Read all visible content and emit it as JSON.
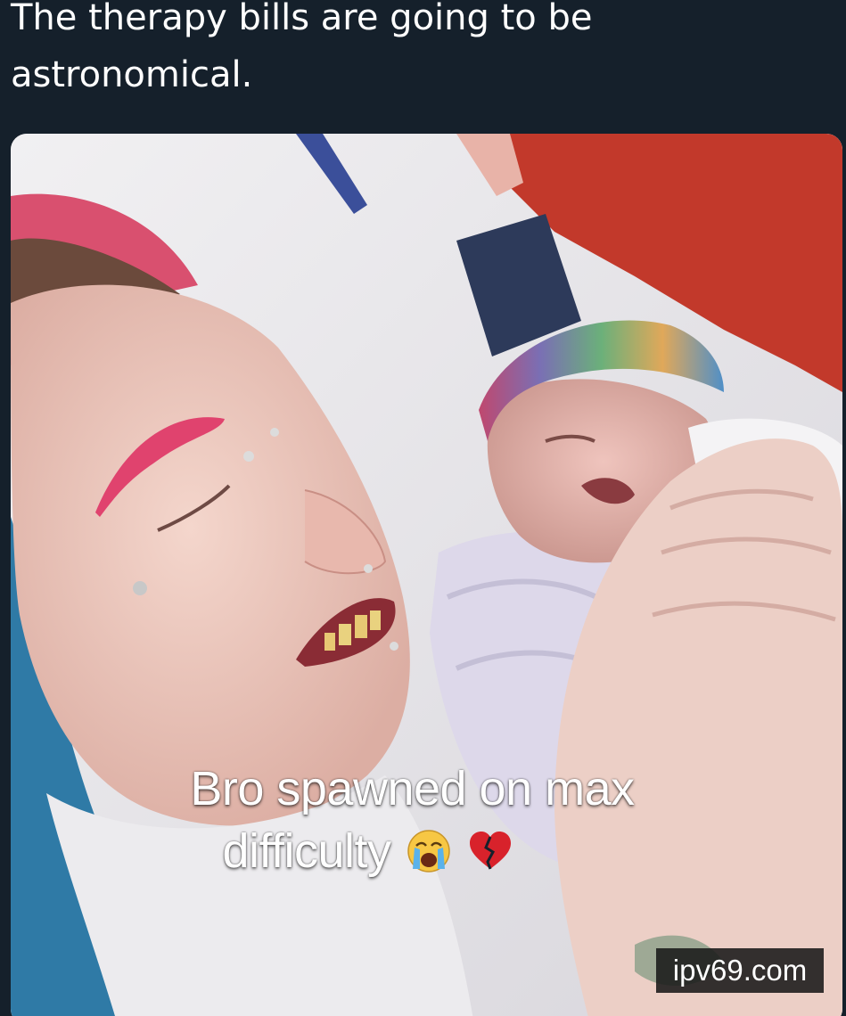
{
  "post": {
    "caption": "The therapy bills are going to be\nastronomical."
  },
  "image": {
    "overlay_line1": "Bro spawned on max",
    "overlay_line2": "difficulty",
    "overlay_emojis": [
      "loudly-crying-face-icon",
      "broken-heart-icon"
    ],
    "watermark": "ipv69.com"
  },
  "colors": {
    "background": "#15202b",
    "caption_text": "#ffffff",
    "watermark_bg": "#191919"
  }
}
